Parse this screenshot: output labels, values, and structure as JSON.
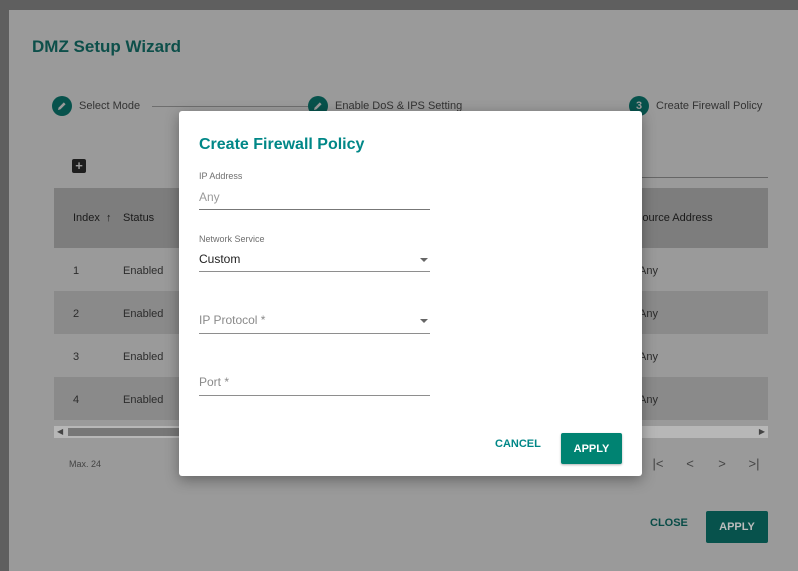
{
  "wizard": {
    "title": "DMZ Setup Wizard",
    "steps": [
      {
        "number": "",
        "label": "Select Mode",
        "icon": "pencil-icon"
      },
      {
        "number": "",
        "label": "Enable DoS & IPS Setting",
        "icon": "pencil-icon"
      },
      {
        "number": "3",
        "label": "Create Firewall Policy",
        "icon": ""
      }
    ],
    "add_icon": "+",
    "table": {
      "headers": {
        "index": "Index",
        "sort_icon": "↑",
        "status": "Status",
        "source_address": "Source Address"
      },
      "rows": [
        {
          "index": "1",
          "status": "Enabled",
          "source": "Any"
        },
        {
          "index": "2",
          "status": "Enabled",
          "source": "Any"
        },
        {
          "index": "3",
          "status": "Enabled",
          "source": "Any"
        },
        {
          "index": "4",
          "status": "Enabled",
          "source": "Any"
        }
      ]
    },
    "max_label": "Max. 24",
    "pager": {
      "first": "|<",
      "prev": "<",
      "next": ">",
      "last": ">|"
    },
    "close_label": "CLOSE",
    "apply_label": "APPLY"
  },
  "dialog": {
    "title": "Create Firewall Policy",
    "ip_address": {
      "label": "IP Address",
      "value": "Any"
    },
    "network_service": {
      "label": "Network Service",
      "value": "Custom"
    },
    "ip_protocol": {
      "placeholder": "IP Protocol *"
    },
    "port": {
      "placeholder": "Port *"
    },
    "cancel_label": "CANCEL",
    "apply_label": "APPLY"
  },
  "colors": {
    "accent": "#008787",
    "apply_button": "#008372",
    "overlay": "#9a9a9a"
  }
}
